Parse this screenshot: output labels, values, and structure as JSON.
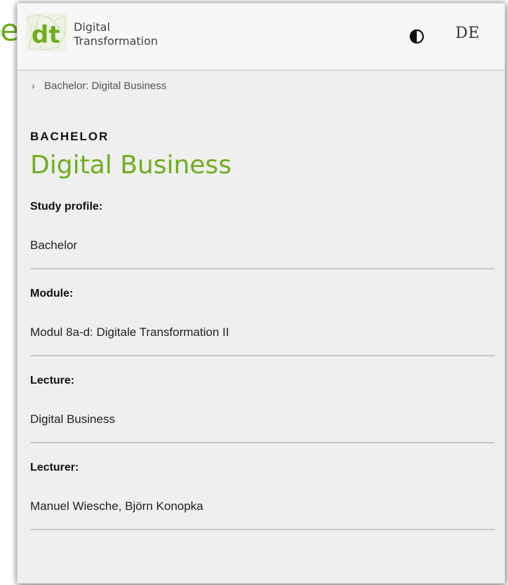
{
  "edge_fragment": "e",
  "header": {
    "logo_letters": "dt",
    "brand_line1": "Digital",
    "brand_line2": "Transformation",
    "contrast_icon": "contrast-icon",
    "language": "DE"
  },
  "breadcrumb": {
    "separator_icon": "chevron-right-icon",
    "items": [
      {
        "label": "Bachelor: Digital Business"
      }
    ]
  },
  "page": {
    "kicker": "BACHELOR",
    "title": "Digital Business"
  },
  "details": [
    {
      "label": "Study profile:",
      "value": "Bachelor"
    },
    {
      "label": "Module:",
      "value": "Modul 8a-d: Digitale Transformation II"
    },
    {
      "label": "Lecture:",
      "value": "Digital Business"
    },
    {
      "label": "Lecturer:",
      "value": "Manuel Wiesche, Björn Konopka"
    }
  ],
  "colors": {
    "accent": "#6fae1e",
    "background": "#efefef",
    "divider": "#c8c8c8"
  }
}
